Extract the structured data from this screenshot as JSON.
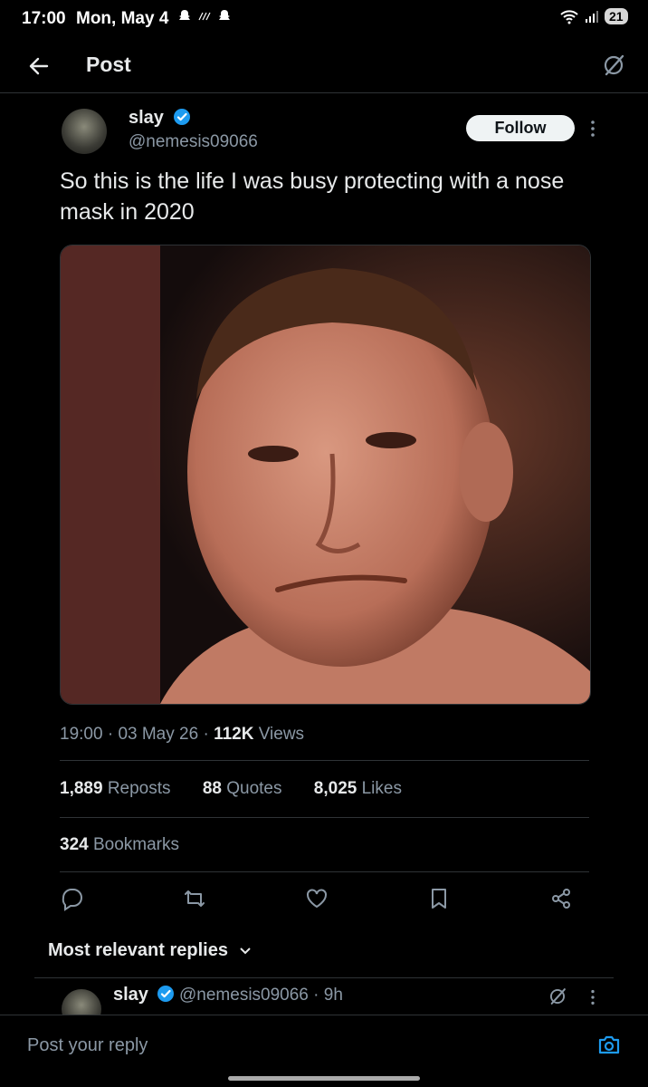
{
  "status_bar": {
    "time": "17:00",
    "date": "Mon, May 4",
    "battery": "21"
  },
  "header": {
    "title": "Post",
    "back_icon": "arrow-left-icon",
    "grok_icon": "grok-icon"
  },
  "post": {
    "author_name": "slay",
    "author_handle": "@nemesis09066",
    "verified": true,
    "follow_label": "Follow",
    "text": "So this is the life I was busy protecting with a nose mask in 2020",
    "time": "19:00",
    "sep1": "·",
    "date": "03 May 26",
    "sep2": "·",
    "views_count": "112K",
    "views_label": "Views",
    "reposts_count": "1,889",
    "reposts_label": "Reposts",
    "quotes_count": "88",
    "quotes_label": "Quotes",
    "likes_count": "8,025",
    "likes_label": "Likes",
    "bookmarks_count": "324",
    "bookmarks_label": "Bookmarks"
  },
  "replies": {
    "sort_label": "Most relevant replies",
    "first": {
      "name": "slay",
      "handle_time": "@nemesis09066 · 9h"
    }
  },
  "composer": {
    "placeholder": "Post your reply"
  },
  "colors": {
    "background": "#000000",
    "accent": "#1d9bf0",
    "muted": "#8b98a5",
    "divider": "#2f3336"
  }
}
